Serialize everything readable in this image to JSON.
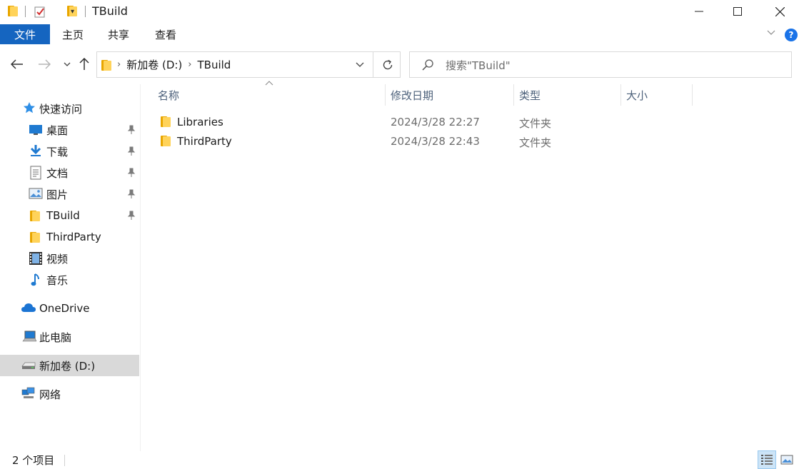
{
  "window": {
    "title": "TBuild",
    "minimize": "—",
    "maximize": "☐",
    "close": "✕"
  },
  "ribbon": {
    "file_tab": "文件",
    "tabs": [
      "主页",
      "共享",
      "查看"
    ],
    "help": "?"
  },
  "address": {
    "breadcrumbs": [
      "新加卷 (D:)",
      "TBuild"
    ]
  },
  "search": {
    "placeholder": "搜索\"TBuild\""
  },
  "sidebar": {
    "quick_access": "快速访问",
    "items": [
      {
        "label": "桌面",
        "icon": "desktop-icon",
        "pinned": true
      },
      {
        "label": "下载",
        "icon": "download-icon",
        "pinned": true
      },
      {
        "label": "文档",
        "icon": "document-icon",
        "pinned": true
      },
      {
        "label": "图片",
        "icon": "picture-icon",
        "pinned": true
      },
      {
        "label": "TBuild",
        "icon": "folder-icon",
        "pinned": true
      },
      {
        "label": "ThirdParty",
        "icon": "folder-icon",
        "pinned": false
      },
      {
        "label": "视频",
        "icon": "video-icon",
        "pinned": false
      },
      {
        "label": "音乐",
        "icon": "music-icon",
        "pinned": false
      }
    ],
    "onedrive": "OneDrive",
    "this_pc": "此电脑",
    "drive": "新加卷 (D:)",
    "network": "网络"
  },
  "columns": {
    "name": "名称",
    "modified": "修改日期",
    "type": "类型",
    "size": "大小"
  },
  "files": [
    {
      "name": "Libraries",
      "modified": "2024/3/28 22:27",
      "type": "文件夹"
    },
    {
      "name": "ThirdParty",
      "modified": "2024/3/28 22:43",
      "type": "文件夹"
    }
  ],
  "status": {
    "item_count": "2 个项目"
  },
  "colors": {
    "accent": "#1565c0",
    "folder": "#ffd35a",
    "selected": "#d9d9d9",
    "header_text": "#4c607a"
  }
}
